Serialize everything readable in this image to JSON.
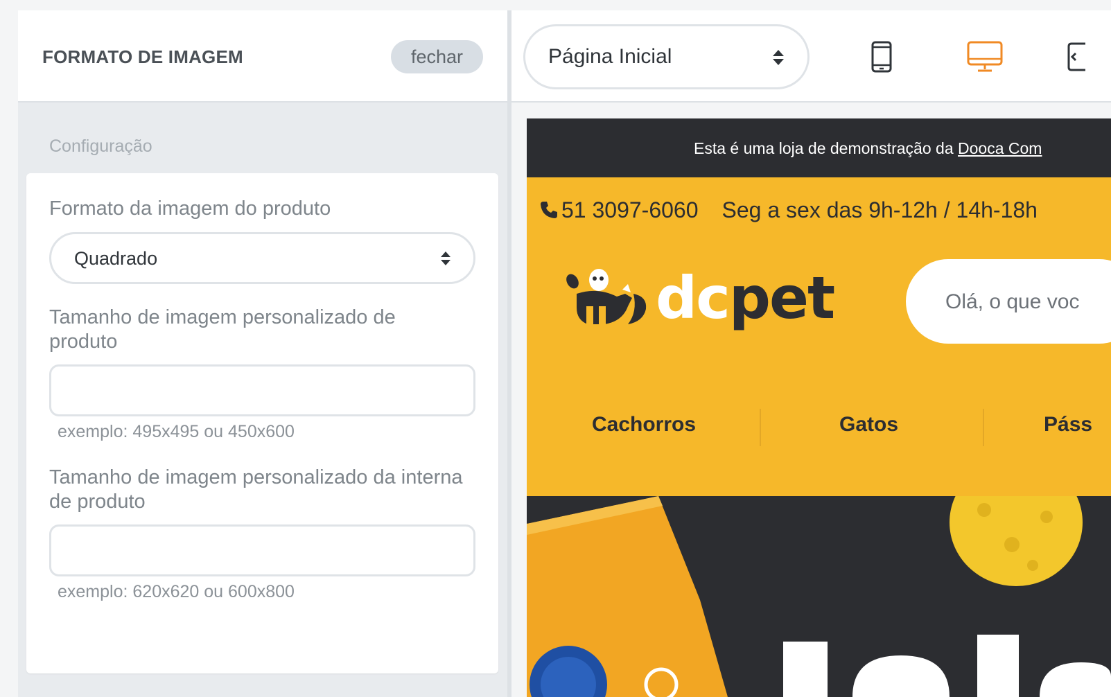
{
  "left_panel": {
    "title": "FORMATO DE IMAGEM",
    "close_label": "fechar",
    "section_label": "Configuração",
    "fields": {
      "format_label": "Formato da imagem do produto",
      "format_value": "Quadrado",
      "custom_size_label": "Tamanho de imagem personalizado de produto",
      "custom_size_value": "",
      "custom_size_hint": "exemplo: 495x495 ou 450x600",
      "internal_size_label": "Tamanho de imagem personalizado da interna de produto",
      "internal_size_value": "",
      "internal_size_hint": "exemplo: 620x620 ou 600x800"
    }
  },
  "toolbar": {
    "page_select_value": "Página Inicial",
    "devices": [
      "mobile-icon",
      "desktop-icon",
      "fullscreen-icon"
    ],
    "active_device": "desktop-icon",
    "accent_color": "#f08a24"
  },
  "preview": {
    "topbar_text": "Esta é uma loja de demonstração da ",
    "topbar_link": "Dooca Com",
    "phone": "51 3097-6060",
    "hours": "Seg a sex das 9h-12h / 14h-18h",
    "logo_dc": "dc",
    "logo_pet": "pet",
    "search_placeholder": "Olá, o que voc",
    "nav": [
      "Cachorros",
      "Gatos",
      "Páss"
    ],
    "brand_color": "#f6b82a",
    "dark_color": "#2c2d31"
  }
}
